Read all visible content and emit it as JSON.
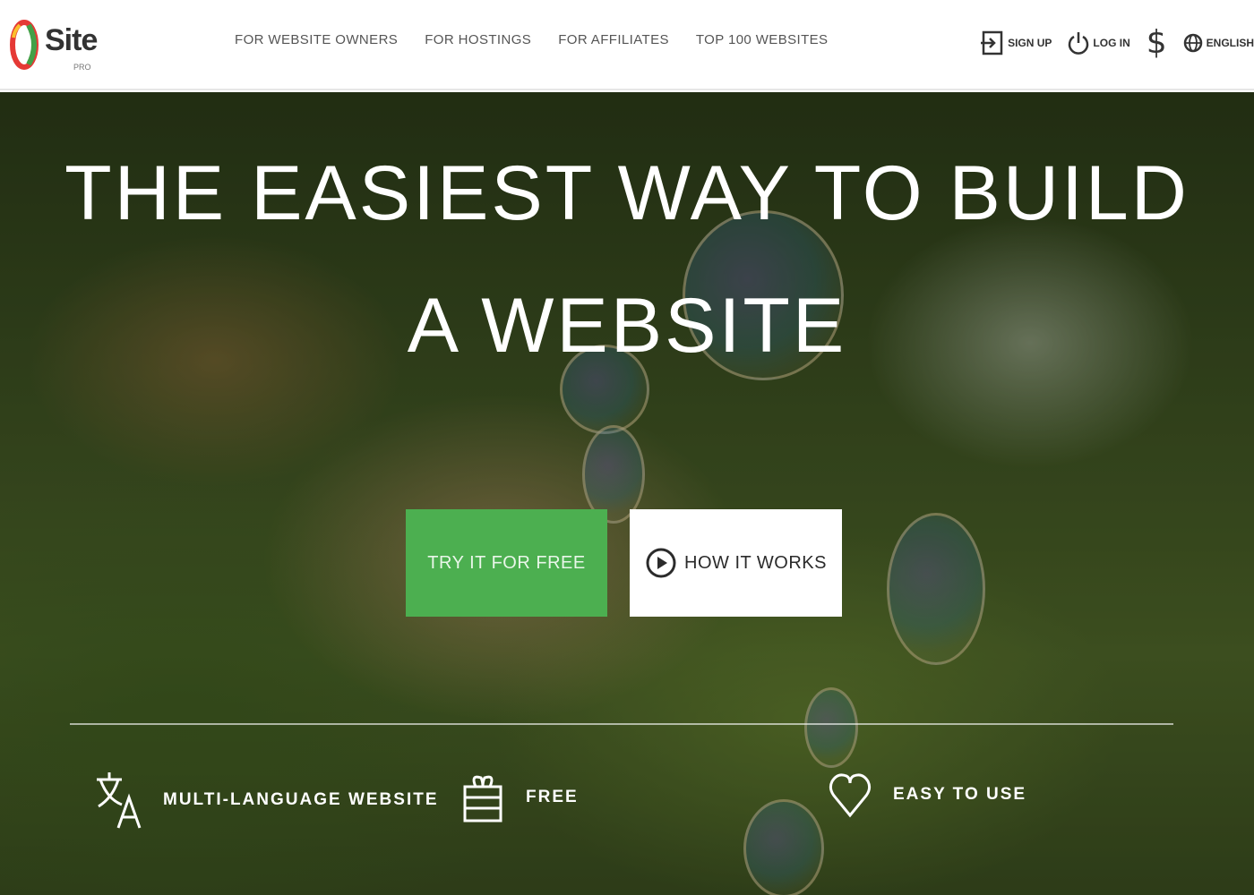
{
  "header": {
    "logo_text": "Site",
    "logo_sub": "PRO",
    "nav": [
      {
        "label": "FOR WEBSITE OWNERS"
      },
      {
        "label": "FOR HOSTINGS"
      },
      {
        "label": "FOR AFFILIATES"
      },
      {
        "label": "TOP 100 WEBSITES"
      }
    ],
    "right": {
      "signup_label": "SIGN UP",
      "login_label": "LOG IN",
      "currency_symbol": "$",
      "language_label": "ENGLISH"
    }
  },
  "hero": {
    "headline_line1": "THE EASIEST WAY TO BUILD",
    "headline_line2": "A WEBSITE",
    "try_button": "TRY IT FOR FREE",
    "how_button": "HOW IT WORKS",
    "features": [
      {
        "label": "MULTI-LANGUAGE WEBSITE",
        "icon": "translate-icon"
      },
      {
        "label": "FREE",
        "icon": "gift-icon"
      },
      {
        "label": "EASY TO USE",
        "icon": "heart-icon"
      }
    ]
  },
  "colors": {
    "accent_green": "#4caf50",
    "logo_red": "#e53935",
    "logo_green": "#43a047"
  }
}
